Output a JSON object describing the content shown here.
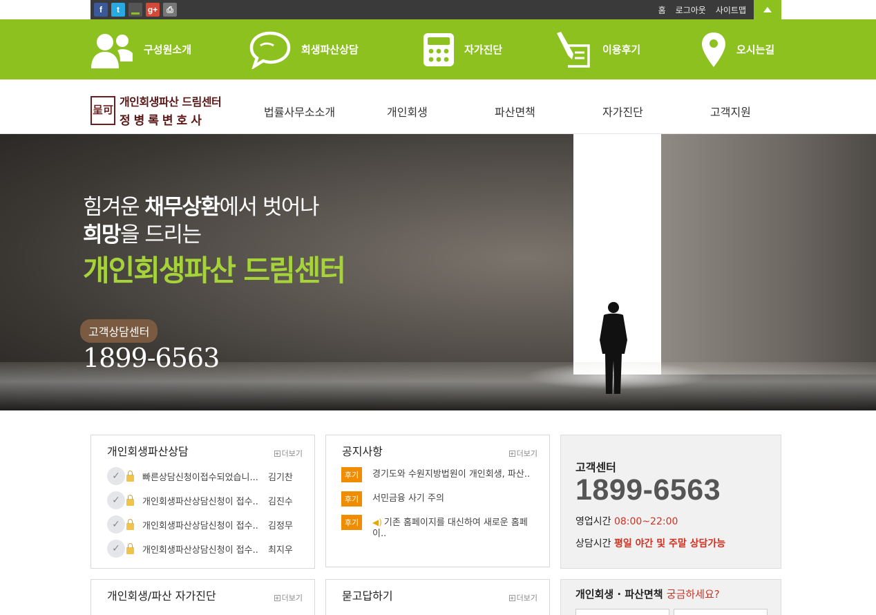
{
  "social": {
    "facebook": "f",
    "twitter": "t",
    "print": "⎙",
    "gplus": "g+"
  },
  "toplinks": [
    "홈",
    "로그아웃",
    "사이트맵"
  ],
  "greenbar": {
    "items": [
      {
        "label": "구성원소개",
        "icon": "people-icon"
      },
      {
        "label": "회생파산상담",
        "icon": "speech-bubble-icon"
      },
      {
        "label": "자가진단",
        "icon": "calculator-icon"
      },
      {
        "label": "이용후기",
        "icon": "pen-paper-icon"
      },
      {
        "label": "오시는길",
        "icon": "map-pin-icon"
      }
    ]
  },
  "logo": {
    "seal": "呈可",
    "line1": "개인회생파산 드림센터",
    "line2": "정병록변호사"
  },
  "nav": [
    "법률사무소소개",
    "개인회생",
    "파산면책",
    "자가진단",
    "고객지원"
  ],
  "hero": {
    "line1_pre": "힘겨운 ",
    "line1_bold": "채무상환",
    "line1_post": "에서 벗어나",
    "line2_bold": "희망",
    "line2_post": "을 드리는",
    "line3": "개인회생파산 드림센터",
    "badge": "고객상담센터",
    "phone": "1899-6563"
  },
  "consult": {
    "title": "개인회생파산상담",
    "more": "더보기",
    "rows": [
      {
        "title": "빠른상담신청이접수되었습니...",
        "name": "김기찬"
      },
      {
        "title": "개인회생파산상담신청이 접수..",
        "name": "김진수"
      },
      {
        "title": "개인회생파산상담신청이 접수..",
        "name": "김정무"
      },
      {
        "title": "개인회생파산상담신청이 접수..",
        "name": "최지우"
      }
    ]
  },
  "notice": {
    "title": "공지사항",
    "more": "더보기",
    "rows": [
      {
        "tag": "후기",
        "text": "경기도와 수원지방법원이 개인회생, 파산.."
      },
      {
        "tag": "후기",
        "text": "서민금융 사기 주의"
      },
      {
        "tag": "후기",
        "text": "기존 홈페이지를 대신하여 새로운 홈페이.."
      }
    ]
  },
  "center": {
    "title": "고객센터",
    "phone": "1899-6563",
    "hours_label": "영업시간",
    "hours_value": "08:00~22:00",
    "consult_label": "상담시간",
    "consult_value": "평일 야간 및 주말 상담가능"
  },
  "selfcheck": {
    "title": "개인회생/파산 자가진단",
    "more": "더보기"
  },
  "qna": {
    "title": "묻고답하기",
    "more": "더보기"
  },
  "question": {
    "title": "개인회생 · 파산면책",
    "title_accent": "궁금하세요?"
  }
}
